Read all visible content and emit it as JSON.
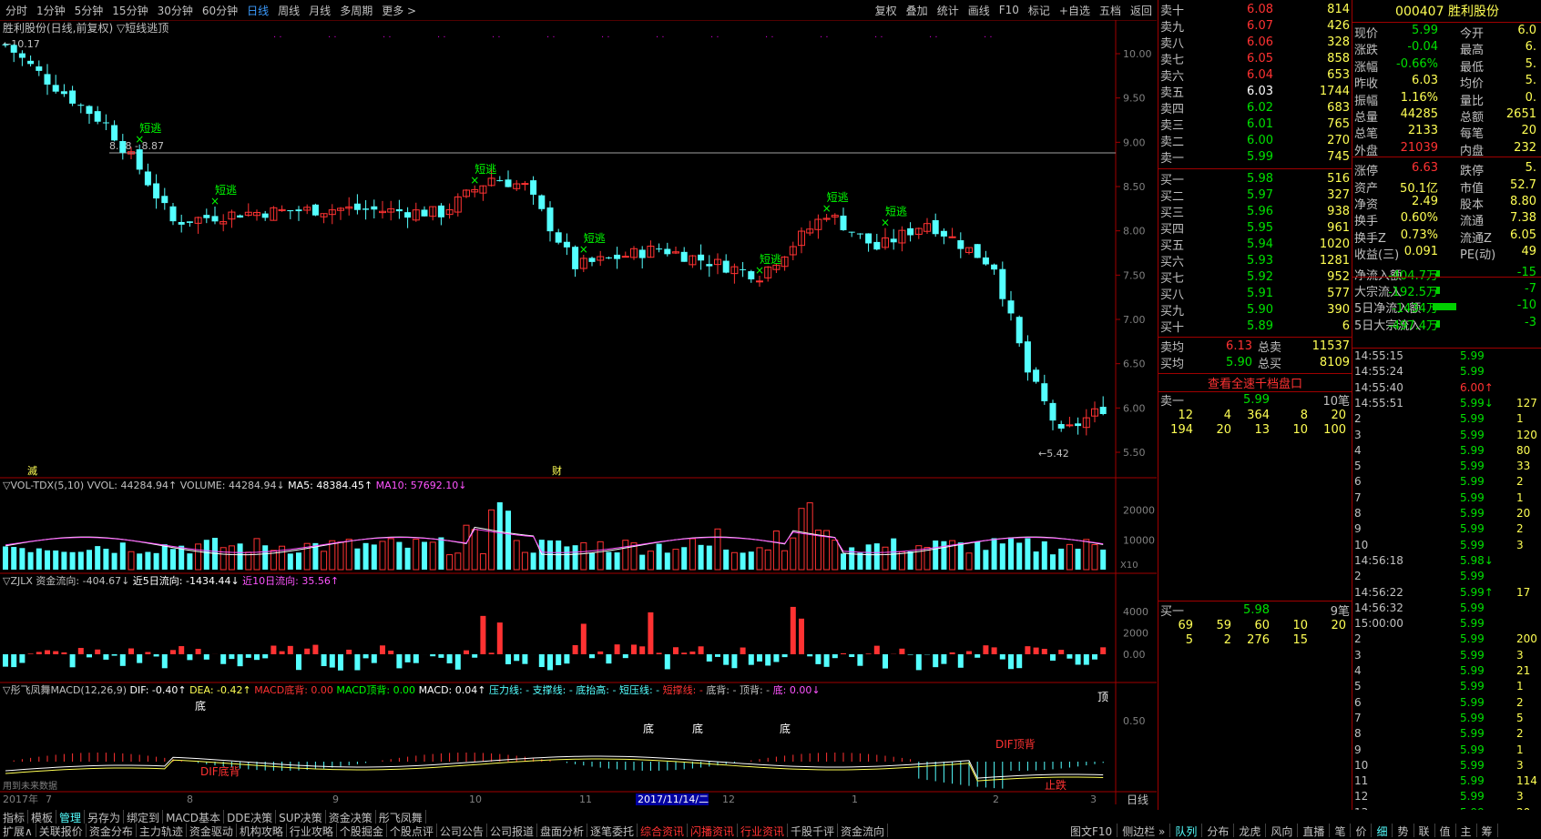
{
  "period_tabs": [
    "分时",
    "1分钟",
    "5分钟",
    "15分钟",
    "30分钟",
    "60分钟",
    "日线",
    "周线",
    "月线",
    "多周期",
    "更多 >"
  ],
  "active_tab": "日线",
  "toolbar_right": [
    "复权",
    "叠加",
    "统计",
    "画线",
    "F10",
    "标记",
    "+自选",
    "五档",
    "返回"
  ],
  "main_panel": {
    "title": "胜利股份(日线,前复权) ▽短线逃顶",
    "high_label": "10.17",
    "range_label": "8.88 - 8.87",
    "low_label": "5.42",
    "escape_label": "短逃",
    "marker_a": "滅",
    "marker_b": "财",
    "y_ticks": [
      "10.00",
      "9.50",
      "9.00",
      "8.50",
      "8.00",
      "7.50",
      "7.00",
      "6.50",
      "6.00",
      "5.50"
    ]
  },
  "vol_panel": {
    "title": "▽VOL-TDX(5,10)",
    "vvol": "VVOL: 44284.94↑",
    "volume": "VOLUME: 44284.94↓",
    "ma5": "MA5: 48384.45↑",
    "ma10": "MA10: 57692.10↓",
    "y_ticks": [
      "20000",
      "10000"
    ],
    "unit": "X10"
  },
  "zjlx_panel": {
    "title": "▽ZJLX",
    "flow": "资金流向: -404.67↓",
    "flow5": "近5日流向: -1434.44↓",
    "flow10": "近10日流向: 35.56↑",
    "y_ticks": [
      "4000",
      "2000",
      "0.00"
    ]
  },
  "macd_panel": {
    "title": "▽彤飞凤舞MACD(12,26,9)",
    "dif": "DIF: -0.40↑",
    "dea": "DEA: -0.42↑",
    "macd_dibei": "MACD底背: 0.00",
    "macd_dingbei": "MACD顶背: 0.00",
    "macd": "MACD: 0.04↑",
    "yaliline": "压力线: -",
    "zhichengline": "支撑线: -",
    "ditaigao": "底抬高: -",
    "duanyaxian": "短压线: -",
    "duanchengxian": "短撑线: -",
    "dibei": "底背: -",
    "dingbei": "顶背: -",
    "di": "底: 0.00↓",
    "y_tick": "0.50",
    "labels": [
      "底",
      "底",
      "底",
      "底",
      "顶",
      "DIF底背",
      "DIF顶背",
      "止跌"
    ],
    "note": "用到未来数据"
  },
  "x_axis": {
    "labels": [
      "2017年",
      "7",
      "8",
      "9",
      "10",
      "11",
      "2017/11/14/二",
      "12",
      "1",
      "2",
      "3"
    ],
    "period": "日线"
  },
  "orderbook": {
    "asks": [
      {
        "label": "卖十",
        "price": "6.08",
        "volume": "814"
      },
      {
        "label": "卖九",
        "price": "6.07",
        "volume": "426"
      },
      {
        "label": "卖八",
        "price": "6.06",
        "volume": "328"
      },
      {
        "label": "卖七",
        "price": "6.05",
        "volume": "858"
      },
      {
        "label": "卖六",
        "price": "6.04",
        "volume": "653"
      },
      {
        "label": "卖五",
        "price": "6.03",
        "volume": "1744"
      },
      {
        "label": "卖四",
        "price": "6.02",
        "volume": "683"
      },
      {
        "label": "卖三",
        "price": "6.01",
        "volume": "765"
      },
      {
        "label": "卖二",
        "price": "6.00",
        "volume": "270"
      },
      {
        "label": "卖一",
        "price": "5.99",
        "volume": "745"
      }
    ],
    "bids": [
      {
        "label": "买一",
        "price": "5.98",
        "volume": "516"
      },
      {
        "label": "买二",
        "price": "5.97",
        "volume": "327"
      },
      {
        "label": "买三",
        "price": "5.96",
        "volume": "938"
      },
      {
        "label": "买四",
        "price": "5.95",
        "volume": "961"
      },
      {
        "label": "买五",
        "price": "5.94",
        "volume": "1020"
      },
      {
        "label": "买六",
        "price": "5.93",
        "volume": "1281"
      },
      {
        "label": "买七",
        "price": "5.92",
        "volume": "952"
      },
      {
        "label": "买八",
        "price": "5.91",
        "volume": "577"
      },
      {
        "label": "买九",
        "price": "5.90",
        "volume": "390"
      },
      {
        "label": "买十",
        "price": "5.89",
        "volume": "6"
      }
    ],
    "avg_ask_label": "卖均",
    "avg_ask": "6.13",
    "total_ask_label": "总卖",
    "total_ask": "11537",
    "avg_bid_label": "买均",
    "avg_bid": "5.90",
    "total_bid_label": "总买",
    "total_bid": "8109",
    "full_depth_link": "查看全速千档盘口",
    "sell1_label": "卖一",
    "sell1_price": "5.99",
    "sell1_count": "10笔",
    "sell1_queue": [
      [
        "12",
        "4",
        "364",
        "8",
        "20"
      ],
      [
        "194",
        "20",
        "13",
        "10",
        "100"
      ]
    ],
    "buy1_label": "买一",
    "buy1_price": "5.98",
    "buy1_count": "9笔",
    "buy1_queue": [
      [
        "69",
        "59",
        "60",
        "10",
        "20"
      ],
      [
        "5",
        "2",
        "276",
        "15",
        ""
      ]
    ]
  },
  "quote": {
    "code": "000407",
    "name": "胜利股份",
    "rows": [
      [
        "现价",
        "5.99",
        "今开",
        "6.0"
      ],
      [
        "涨跌",
        "-0.04",
        "最高",
        "6."
      ],
      [
        "涨幅",
        "-0.66%",
        "最低",
        "5."
      ],
      [
        "昨收",
        "6.03",
        "均价",
        "5."
      ],
      [
        "振幅",
        "1.16%",
        "量比",
        "0."
      ],
      [
        "总量",
        "44285",
        "总额",
        "2651"
      ],
      [
        "总笔",
        "2133",
        "每笔",
        "20"
      ],
      [
        "外盘",
        "21039",
        "内盘",
        "232"
      ],
      [
        "涨停",
        "6.63",
        "跌停",
        "5."
      ],
      [
        "资产",
        "50.1亿",
        "市值",
        "52.7"
      ],
      [
        "净资",
        "2.49",
        "股本",
        "8.80"
      ],
      [
        "换手",
        "0.60%",
        "流通",
        "7.38"
      ],
      [
        "换手Z",
        "0.73%",
        "流通Z",
        "6.05"
      ],
      [
        "收益(三)",
        "0.091",
        "PE(动)",
        "49"
      ],
      [
        "净流入额",
        "-404.7万",
        "",
        "-15"
      ],
      [
        "大宗流入",
        "-192.5万",
        "",
        "-7"
      ],
      [
        "5日净流入额",
        "-1434万",
        "",
        "-10"
      ],
      [
        "5日大宗流入",
        "-497.4万",
        "",
        "-3"
      ]
    ],
    "ticks": [
      [
        "14:55:15",
        "5.99",
        ""
      ],
      [
        "14:55:24",
        "5.99",
        ""
      ],
      [
        "14:55:40",
        "6.00↑",
        ""
      ],
      [
        "14:55:51",
        "5.99↓",
        "127"
      ],
      [
        "2",
        "5.99",
        "1"
      ],
      [
        "3",
        "5.99",
        "120"
      ],
      [
        "4",
        "5.99",
        "80"
      ],
      [
        "5",
        "5.99",
        "33"
      ],
      [
        "6",
        "5.99",
        "2"
      ],
      [
        "7",
        "5.99",
        "1"
      ],
      [
        "8",
        "5.99",
        "20"
      ],
      [
        "9",
        "5.99",
        "2"
      ],
      [
        "10",
        "5.99",
        "3"
      ],
      [
        "14:56:18",
        "5.98↓",
        ""
      ],
      [
        "2",
        "5.99",
        ""
      ],
      [
        "14:56:22",
        "5.99↑",
        "17"
      ],
      [
        "14:56:32",
        "5.99",
        ""
      ],
      [
        "15:00:00",
        "5.99",
        ""
      ],
      [
        "2",
        "5.99",
        "200"
      ],
      [
        "3",
        "5.99",
        "3"
      ],
      [
        "4",
        "5.99",
        "21"
      ],
      [
        "5",
        "5.99",
        "1"
      ],
      [
        "6",
        "5.99",
        "2"
      ],
      [
        "7",
        "5.99",
        "5"
      ],
      [
        "8",
        "5.99",
        "2"
      ],
      [
        "9",
        "5.99",
        "1"
      ],
      [
        "10",
        "5.99",
        "3"
      ],
      [
        "11",
        "5.99",
        "114"
      ],
      [
        "12",
        "5.99",
        "3"
      ],
      [
        "13",
        "5.99",
        "20"
      ]
    ]
  },
  "bottom_row1": [
    "指标",
    "模板",
    "管理",
    "另存为",
    "绑定到",
    "MACD基本",
    "DDE决策",
    "SUP决策",
    "资金决策",
    "彤飞凤舞"
  ],
  "bottom_row2": [
    "扩展∧",
    "关联报价",
    "资金分布",
    "主力轨迹",
    "资金驱动",
    "机构攻略",
    "行业攻略",
    "个股掘金",
    "个股点评",
    "公司公告",
    "公司报道",
    "盘面分析",
    "逐笔委托",
    "综合资讯",
    "闪播资讯",
    "行业资讯",
    "千股千评",
    "资金流向"
  ],
  "bottom_right": [
    "图文F10",
    "侧边栏 »",
    "队列",
    "分布",
    "龙虎",
    "风向",
    "直播",
    "笔",
    "价",
    "细",
    "势",
    "联",
    "值",
    "主",
    "筹"
  ],
  "colors": {
    "up": "#ff3232",
    "down": "#54ffff",
    "yellow": "#ffff54",
    "magenta": "#ff54ff",
    "green": "#00d000",
    "white": "#ffffff",
    "grid": "#a00000"
  }
}
